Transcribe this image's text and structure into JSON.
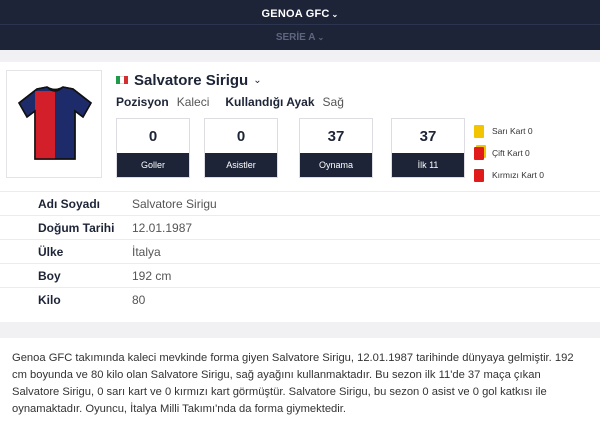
{
  "header": {
    "team_label": "GENOA GFC",
    "league_label": "SERİE A"
  },
  "player": {
    "name": "Salvatore Sirigu",
    "flag_colors": [
      "#1f9a48",
      "#ffffff",
      "#d32f2f"
    ],
    "jersey_colors": {
      "blue": "#1d2b6b",
      "red": "#d21f2a"
    },
    "position_label": "Pozisyon",
    "position_value": "Kaleci",
    "foot_label": "Kullandığı Ayak",
    "foot_value": "Sağ"
  },
  "stats": [
    {
      "value": "0",
      "label": "Goller"
    },
    {
      "value": "0",
      "label": "Asistler"
    },
    {
      "value": "37",
      "label": "Oynama"
    },
    {
      "value": "37",
      "label": "İlk 11"
    }
  ],
  "cards": [
    {
      "label": "Sarı Kart 0",
      "color": "#f2c500"
    },
    {
      "label": "Çift Kart 0",
      "color": "#e11b1b"
    },
    {
      "label": "Kırmızı Kart 0",
      "color": "#e11b1b"
    }
  ],
  "info": [
    {
      "key": "Adı Soyadı",
      "value": "Salvatore Sirigu"
    },
    {
      "key": "Doğum Tarihi",
      "value": "12.01.1987"
    },
    {
      "key": "Ülke",
      "value": "İtalya"
    },
    {
      "key": "Boy",
      "value": "192 cm"
    },
    {
      "key": "Kilo",
      "value": "80"
    }
  ],
  "description": "Genoa GFC takımında kaleci mevkinde forma giyen Salvatore Sirigu, 12.01.1987 tarihinde dünyaya gelmiştir. 192 cm boyunda ve 80 kilo olan Salvatore Sirigu, sağ ayağını kullanmaktadır. Bu sezon ilk 11'de 37 maça çıkan Salvatore Sirigu, 0 sarı kart ve 0 kırmızı kart görmüştür. Salvatore Sirigu, bu sezon 0 asist ve 0 gol katkısı ile oynamaktadır. Oyuncu, İtalya Milli Takımı'nda da forma giymektedir."
}
